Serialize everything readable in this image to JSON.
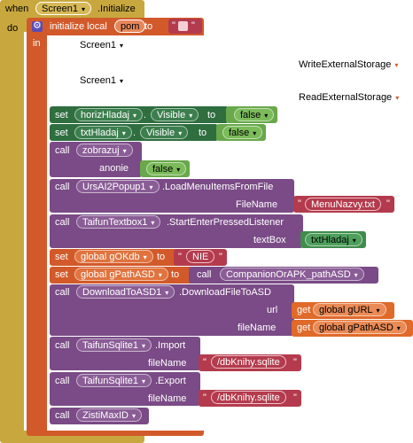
{
  "event": {
    "when": "when",
    "component": "Screen1",
    "method": ".Initialize",
    "do": "do"
  },
  "local": {
    "label": "initialize local",
    "name": "pom",
    "to": "to",
    "in": "in",
    "row1_comp": "Screen1",
    "row1_perm": "WriteExternalStorage",
    "row2_comp": "Screen1",
    "row2_perm": "ReadExternalStorage"
  },
  "blocks": {
    "set1": {
      "set": "set",
      "comp": "horizHladaj",
      "prop": "Visible",
      "to": "to",
      "value": "false"
    },
    "set2": {
      "set": "set",
      "comp": "txtHladaj",
      "prop": "Visible",
      "to": "to",
      "value": "false"
    },
    "call1": {
      "call": "call",
      "proc": "zobrazuj",
      "arg": "anonie",
      "value": "false"
    },
    "call2": {
      "call": "call",
      "comp": "UrsAI2Popup1",
      "method": ".LoadMenuItemsFromFile",
      "arg": "FileName",
      "value": "MenuNazvy.txt"
    },
    "call3": {
      "call": "call",
      "comp": "TaifunTextbox1",
      "method": ".StartEnterPressedListener",
      "arg": "textBox",
      "value": "txtHladaj"
    },
    "setg1": {
      "set": "set",
      "var": "global gOKdb",
      "to": "to",
      "value": "NIE"
    },
    "setg2": {
      "set": "set",
      "var": "global gPathASD",
      "to": "to",
      "call": "call",
      "proc": "CompanionOrAPK_pathASD"
    },
    "call4": {
      "call": "call",
      "comp": "DownloadToASD1",
      "method": ".DownloadFileToASD",
      "arg1": "url",
      "get1": "get",
      "val1": "global gURL",
      "arg2": "fileName",
      "get2": "get",
      "val2": "global gPathASD"
    },
    "call5": {
      "call": "call",
      "comp": "TaifunSqlite1",
      "method": ".Import",
      "arg": "fileName",
      "value": "/dbKnihy.sqlite"
    },
    "call6": {
      "call": "call",
      "comp": "TaifunSqlite1",
      "method": ".Export",
      "arg": "fileName",
      "value": "/dbKnihy.sqlite"
    },
    "call7": {
      "call": "call",
      "proc": "ZistiMaxID"
    }
  },
  "colors": {
    "control": "#c8a83e",
    "variable": "#d25a2a",
    "procedure": "#7a4b86",
    "component_set": "#2f6e3f",
    "logic": "#69a84b",
    "text": "#b33b4d"
  }
}
